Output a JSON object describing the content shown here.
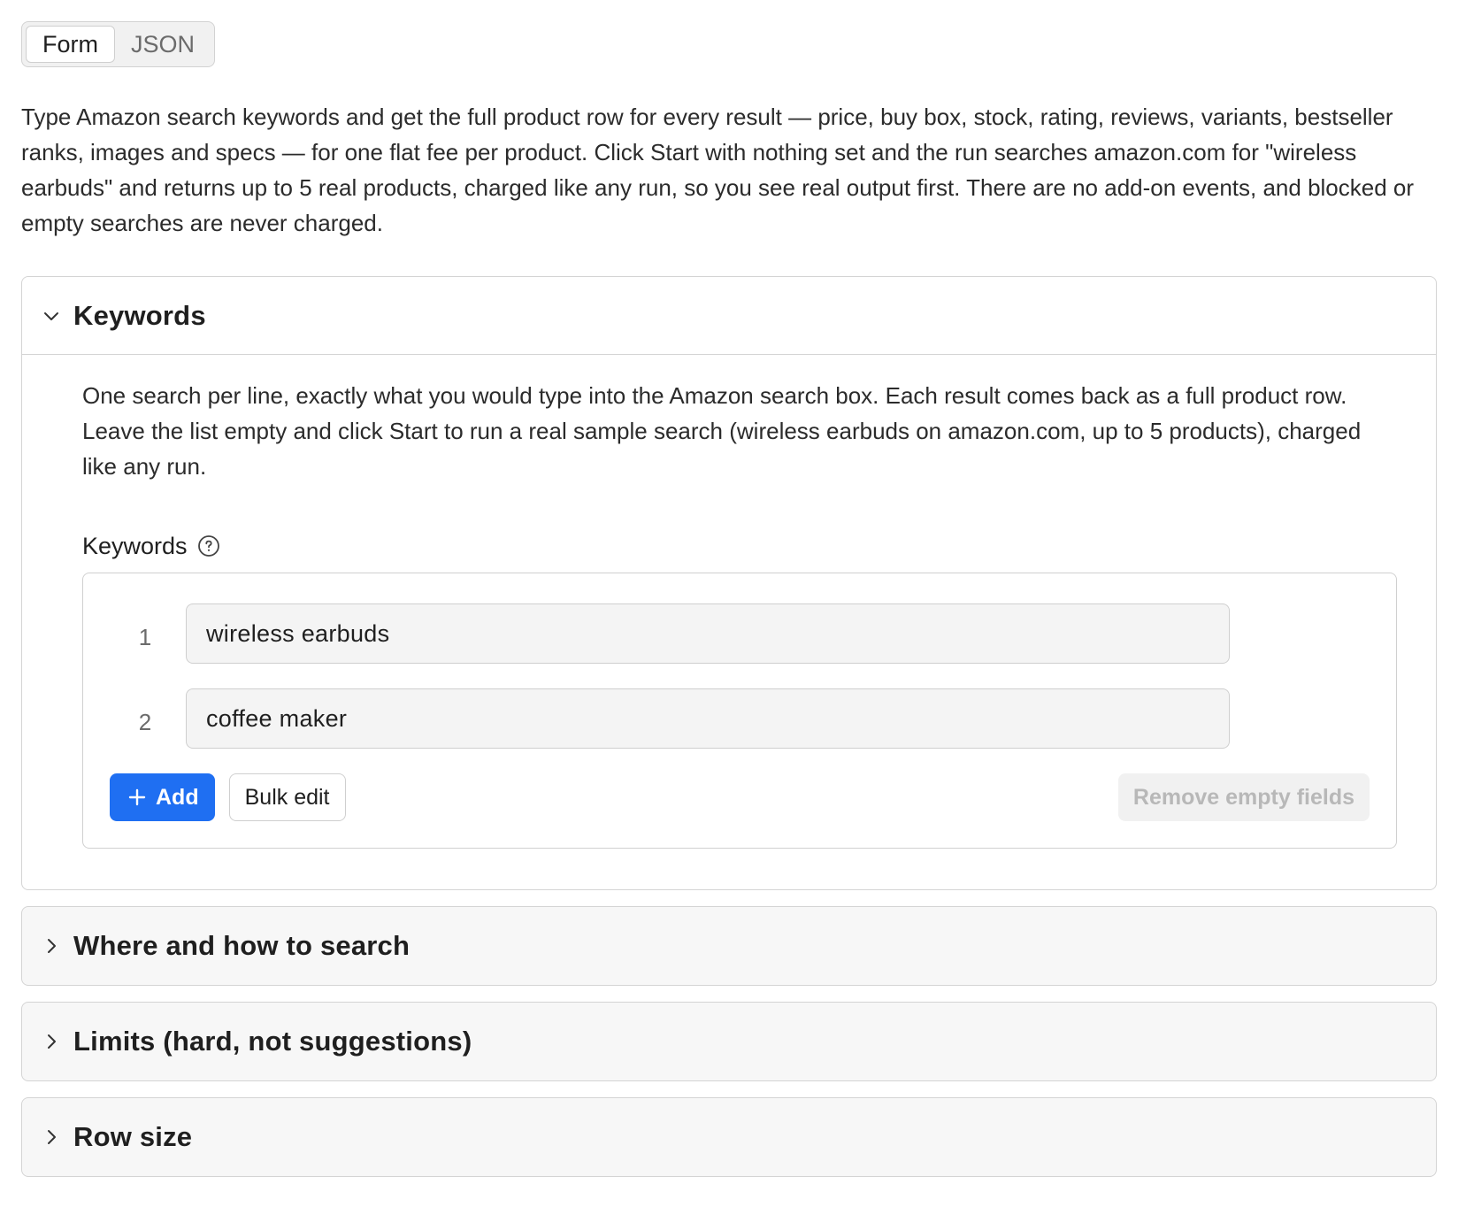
{
  "mode_toggle": {
    "form_label": "Form",
    "json_label": "JSON",
    "active": "Form"
  },
  "intro": "Type Amazon search keywords and get the full product row for every result — price, buy box, stock, rating, reviews, variants, bestseller ranks, images and specs — for one flat fee per product. Click Start with nothing set and the run searches amazon.com for \"wireless earbuds\" and returns up to 5 real products, charged like any run, so you see real output first. There are no add-on events, and blocked or empty searches are never charged.",
  "keywords_section": {
    "title": "Keywords",
    "description": "One search per line, exactly what you would type into the Amazon search box. Each result comes back as a full product row. Leave the list empty and click Start to run a real sample search (wireless earbuds on amazon.com, up to 5 products), charged like any run.",
    "field_label": "Keywords",
    "rows": [
      {
        "num": "1",
        "value": "wireless earbuds"
      },
      {
        "num": "2",
        "value": "coffee maker"
      }
    ],
    "add_label": "Add",
    "bulk_edit_label": "Bulk edit",
    "remove_empty_label": "Remove empty fields"
  },
  "collapsed_sections": [
    {
      "title": "Where and how to search"
    },
    {
      "title": "Limits (hard, not suggestions)"
    },
    {
      "title": "Row size"
    }
  ],
  "colors": {
    "accent": "#1f6ff2",
    "border": "#d4d4d4",
    "collapsed_bg": "#f7f7f7",
    "input_bg": "#f4f4f4",
    "disabled_text": "#b8b8b8"
  },
  "icons": {
    "expanded_chevron": "chevron-down-icon",
    "collapsed_chevron": "chevron-right-icon",
    "help": "help-circle-icon",
    "add": "plus-icon"
  }
}
